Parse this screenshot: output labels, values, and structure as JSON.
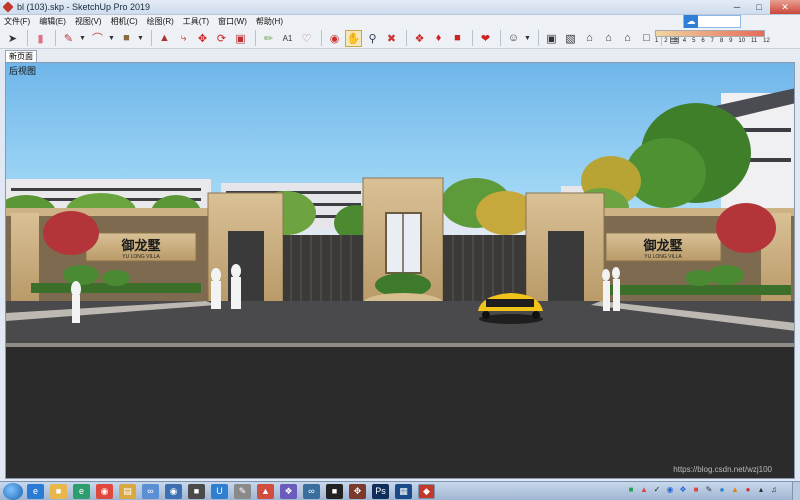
{
  "window": {
    "title": "bl (103).skp - SketchUp Pro 2019",
    "minimize_icon": "minimize-icon",
    "maximize_icon": "maximize-icon",
    "close_icon": "close-icon"
  },
  "menu": [
    "文件(F)",
    "编辑(E)",
    "视图(V)",
    "相机(C)",
    "绘图(R)",
    "工具(T)",
    "窗口(W)",
    "帮助(H)"
  ],
  "toolbar": {
    "tools": [
      "select-icon",
      "eraser-icon",
      "line-icon",
      "arc-icon",
      "rectangle-icon",
      "push-pull-icon",
      "follow-me-icon",
      "move-icon",
      "scale-icon",
      "offset-icon",
      "tape-measure-icon",
      "text-icon",
      "paint-bucket-icon",
      "orbit-icon",
      "pan-icon",
      "zoom-icon",
      "zoom-extents-icon",
      "components-icon",
      "materials-icon",
      "styles-icon",
      "warehouse-icon",
      "user-icon",
      "views-icon",
      "section-icon",
      "home-icon",
      "front-icon",
      "back-icon",
      "shadow-icon"
    ],
    "layer_scale": [
      "1",
      "2",
      "3",
      "4",
      "5",
      "6",
      "7",
      "8",
      "9",
      "10",
      "11",
      "12"
    ]
  },
  "tabs": {
    "scene_tab": "新页面"
  },
  "viewport": {
    "view_label": "后视图",
    "sign_left": {
      "title": "御龙墅",
      "subtitle": "YU LONG VILLA"
    },
    "sign_right": {
      "title": "御龙墅",
      "subtitle": "YU LONG VILLA"
    },
    "watermark": "https://blog.csdn.net/wzj100"
  },
  "taskbar": {
    "apps": [
      "start",
      "ie-icon",
      "folder-icon",
      "browser-icon",
      "chrome-icon",
      "file-manager-icon",
      "app-icon",
      "app-icon",
      "app-icon",
      "app-icon",
      "app-icon",
      "app-icon",
      "app-icon",
      "app-icon",
      "app-icon",
      "photoshop-icon",
      "app-icon",
      "sketchup-icon"
    ],
    "tray_icons": [
      "tray-1",
      "tray-2",
      "tray-3",
      "tray-4",
      "tray-5",
      "tray-6",
      "tray-7",
      "tray-8",
      "tray-9",
      "tray-10",
      "tray-11",
      "tray-12"
    ]
  },
  "colors": {
    "sky": "#7ec2ee",
    "road": "#2b2b2b",
    "stone": "#cdb285",
    "gate": "#3a3a3a",
    "car": "#f2c318",
    "accent_red": "#c23a2e",
    "tree_green": "#3f7f2a"
  }
}
